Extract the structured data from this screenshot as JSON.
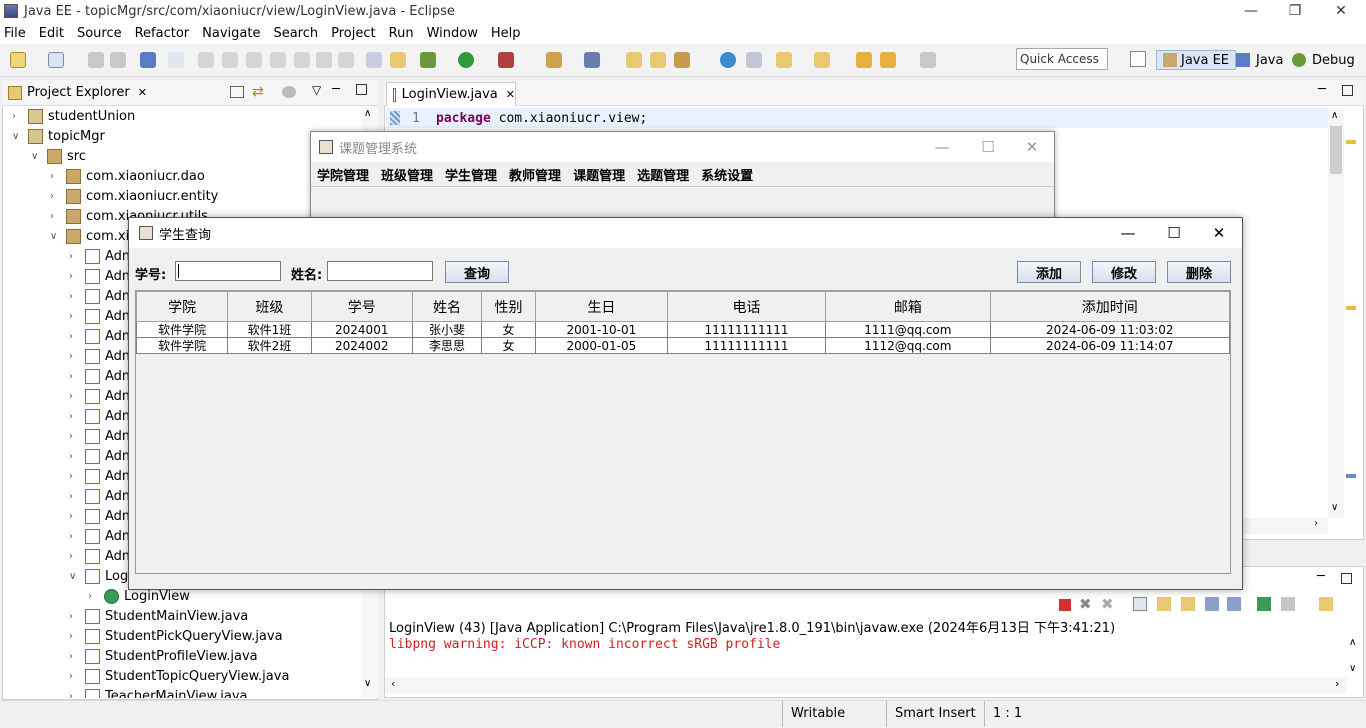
{
  "window": {
    "title": "Java EE - topicMgr/src/com/xiaoniucr/view/LoginView.java - Eclipse"
  },
  "menu": [
    "File",
    "Edit",
    "Source",
    "Refactor",
    "Navigate",
    "Search",
    "Project",
    "Run",
    "Window",
    "Help"
  ],
  "toolbar": {
    "quick_access": "Quick Access",
    "persp_javaee": "Java EE",
    "persp_java": "Java",
    "persp_debug": "Debug"
  },
  "explorer": {
    "title": "Project Explorer",
    "rows": [
      {
        "label": "studentUnion",
        "indent": 0,
        "twisty": ">",
        "icon": "project"
      },
      {
        "label": "topicMgr",
        "indent": 0,
        "twisty": "v",
        "icon": "project"
      },
      {
        "label": "src",
        "indent": 1,
        "twisty": "v",
        "icon": "folder"
      },
      {
        "label": "com.xiaoniucr.dao",
        "indent": 2,
        "twisty": ">",
        "icon": "package"
      },
      {
        "label": "com.xiaoniucr.entity",
        "indent": 2,
        "twisty": ">",
        "icon": "package"
      },
      {
        "label": "com.xiaoniucr.utils",
        "indent": 2,
        "twisty": ">",
        "icon": "package"
      },
      {
        "label": "com.xia",
        "indent": 2,
        "twisty": "v",
        "icon": "package"
      },
      {
        "label": "Adm",
        "indent": 3,
        "twisty": ">",
        "icon": "java"
      },
      {
        "label": "Adm",
        "indent": 3,
        "twisty": ">",
        "icon": "java"
      },
      {
        "label": "Adm",
        "indent": 3,
        "twisty": ">",
        "icon": "java"
      },
      {
        "label": "Adm",
        "indent": 3,
        "twisty": ">",
        "icon": "java"
      },
      {
        "label": "Adm",
        "indent": 3,
        "twisty": ">",
        "icon": "java"
      },
      {
        "label": "Adm",
        "indent": 3,
        "twisty": ">",
        "icon": "java"
      },
      {
        "label": "Adm",
        "indent": 3,
        "twisty": ">",
        "icon": "java"
      },
      {
        "label": "Adm",
        "indent": 3,
        "twisty": ">",
        "icon": "java"
      },
      {
        "label": "Adm",
        "indent": 3,
        "twisty": ">",
        "icon": "java"
      },
      {
        "label": "Adm",
        "indent": 3,
        "twisty": ">",
        "icon": "java"
      },
      {
        "label": "Adm",
        "indent": 3,
        "twisty": ">",
        "icon": "java"
      },
      {
        "label": "Adm",
        "indent": 3,
        "twisty": ">",
        "icon": "java"
      },
      {
        "label": "Adm",
        "indent": 3,
        "twisty": ">",
        "icon": "java"
      },
      {
        "label": "Adm",
        "indent": 3,
        "twisty": ">",
        "icon": "java"
      },
      {
        "label": "Adm",
        "indent": 3,
        "twisty": ">",
        "icon": "java"
      },
      {
        "label": "Adm",
        "indent": 3,
        "twisty": ">",
        "icon": "java"
      },
      {
        "label": "Log",
        "indent": 3,
        "twisty": "v",
        "icon": "java"
      },
      {
        "label": "LoginView",
        "indent": 4,
        "twisty": ">",
        "icon": "class"
      },
      {
        "label": "StudentMainView.java",
        "indent": 3,
        "twisty": ">",
        "icon": "java"
      },
      {
        "label": "StudentPickQueryView.java",
        "indent": 3,
        "twisty": ">",
        "icon": "java"
      },
      {
        "label": "StudentProfileView.java",
        "indent": 3,
        "twisty": ">",
        "icon": "java"
      },
      {
        "label": "StudentTopicQueryView.java",
        "indent": 3,
        "twisty": ">",
        "icon": "java"
      },
      {
        "label": "TeacherMainView.java",
        "indent": 3,
        "twisty": ">",
        "icon": "java"
      }
    ]
  },
  "editor": {
    "tab": "LoginView.java",
    "line_no": "1",
    "code_kw": "package",
    "code_rest": " com.xiaoniucr.view;"
  },
  "console": {
    "launch": "LoginView (43) [Java Application] C:\\Program Files\\Java\\jre1.8.0_191\\bin\\javaw.exe (2024年6月13日 下午3:41:21)",
    "output": "libpng warning: iCCP: known incorrect sRGB profile"
  },
  "status": {
    "writable": "Writable",
    "insert": "Smart Insert",
    "position": "1 : 1"
  },
  "main_window": {
    "title": "课题管理系统",
    "menus": [
      "学院管理",
      "班级管理",
      "学生管理",
      "教师管理",
      "课题管理",
      "选题管理",
      "系统设置"
    ]
  },
  "query_window": {
    "title": "学生查询",
    "label_no": "学号:",
    "label_name": "姓名:",
    "query_btn": "查询",
    "add_btn": "添加",
    "edit_btn": "修改",
    "delete_btn": "删除",
    "columns": [
      "学院",
      "班级",
      "学号",
      "姓名",
      "性别",
      "生日",
      "电话",
      "邮箱",
      "添加时间"
    ],
    "rows": [
      [
        "软件学院",
        "软件1班",
        "2024001",
        "张小斐",
        "女",
        "2001-10-01",
        "11111111111",
        "1111@qq.com",
        "2024-06-09 11:03:02"
      ],
      [
        "软件学院",
        "软件2班",
        "2024002",
        "李思思",
        "女",
        "2000-01-05",
        "11111111111",
        "1112@qq.com",
        "2024-06-09 11:14:07"
      ]
    ]
  }
}
